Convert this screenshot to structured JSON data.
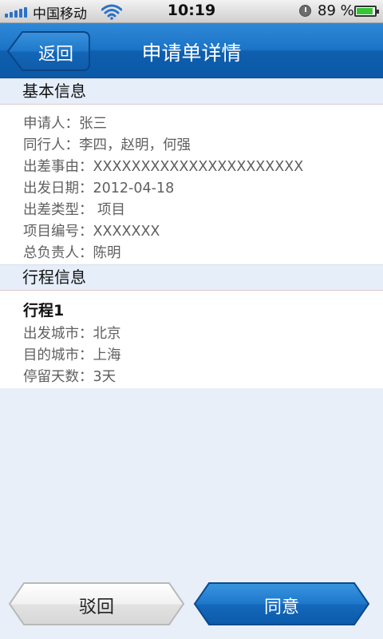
{
  "status_bar": {
    "carrier": "中国移动",
    "time": "10:19",
    "battery_pct": "89 %",
    "battery_level": 0.89,
    "icons": [
      "signal-icon",
      "wifi-icon",
      "alarm-icon",
      "battery-icon"
    ]
  },
  "nav": {
    "back_label": "返回",
    "title": "申请单详情"
  },
  "basic_info": {
    "header": "基本信息",
    "rows": [
      "申请人：张三",
      "同行人：李四，赵明，何强",
      "出差事由：XXXXXXXXXXXXXXXXXXXXXX",
      "出发日期：2012-04-18",
      "出差类型： 项目",
      "项目编号：XXXXXXX",
      "总负责人：陈明"
    ]
  },
  "itinerary": {
    "header": "行程信息",
    "trips": [
      {
        "name": "行程1",
        "rows": [
          "出发城市：北京",
          "目的城市：上海",
          "停留天数：3天"
        ]
      }
    ]
  },
  "actions": {
    "reject_label": "驳回",
    "agree_label": "同意"
  },
  "colors": {
    "nav_blue": "#1b74c7",
    "page_bg": "#e9eff9",
    "section_header_bg": "#e6eefa",
    "row_text": "#5f5f5f"
  }
}
